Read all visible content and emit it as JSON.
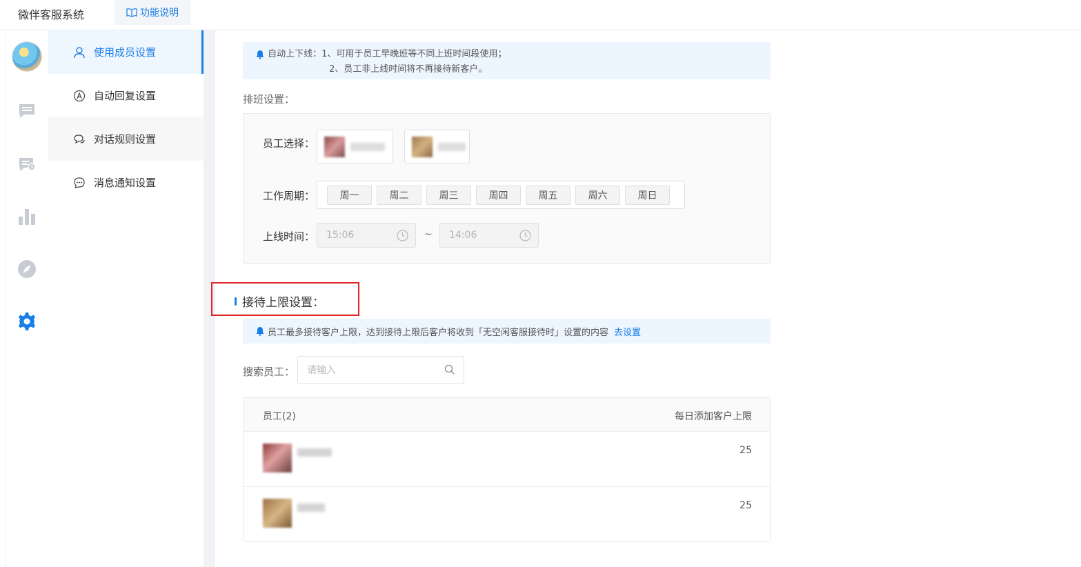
{
  "topbar": {
    "app_title": "微伴客服系统",
    "help_label": "功能说明"
  },
  "iconbar": {
    "items": [
      "avatar",
      "chat-icon",
      "chat-history-icon",
      "bar-chart-icon",
      "compass-icon",
      "settings-gear-icon"
    ],
    "active": "settings-gear-icon",
    "accent": "#1a7ee8"
  },
  "submenu": {
    "items": [
      {
        "label": "使用成员设置",
        "icon": "user-icon",
        "active": true
      },
      {
        "label": "自动回复设置",
        "icon": "auto-reply-icon",
        "active": false
      },
      {
        "label": "对话规则设置",
        "icon": "dialog-rules-icon",
        "active": false
      },
      {
        "label": "消息通知设置",
        "icon": "message-notify-icon",
        "active": false
      }
    ]
  },
  "auto_online_notice": {
    "line1": "自动上下线：1、可用于员工早晚班等不同上班时间段使用；",
    "line2": "2、员工非上线时间将不再接待新客户。"
  },
  "schedule": {
    "section_label": "排班设置：",
    "employee_label": "员工选择：",
    "period_label": "工作周期：",
    "days": [
      "周一",
      "周二",
      "周三",
      "周四",
      "周五",
      "周六",
      "周日"
    ],
    "time_label": "上线时间：",
    "start_time": "15:06",
    "end_time": "14:06",
    "separator": "~"
  },
  "limit": {
    "title": "接待上限设置：",
    "notice_text": "员工最多接待客户上限，达到接待上限后客户将收到「无空闲客服接待时」设置的内容",
    "notice_link": "去设置",
    "search_label": "搜索员工：",
    "search_placeholder": "请输入",
    "table": {
      "col_employee": "员工(2)",
      "col_limit": "每日添加客户上限",
      "rows": [
        {
          "limit": "25"
        },
        {
          "limit": "25"
        }
      ]
    }
  }
}
